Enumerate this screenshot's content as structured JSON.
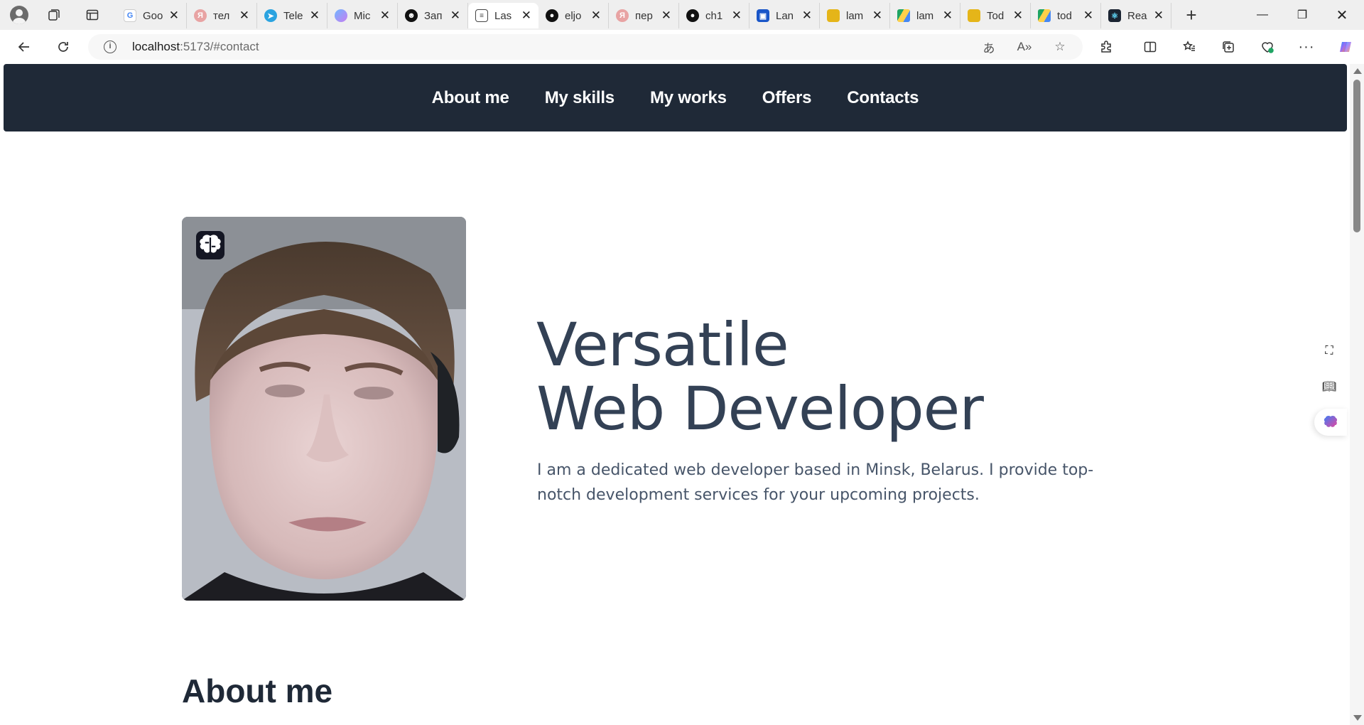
{
  "browser": {
    "tabs": [
      {
        "title": "Goo",
        "icon": "google-icon",
        "color": "#ffffff"
      },
      {
        "title": "тел",
        "icon": "yandex-icon",
        "color": "#e8a3a3"
      },
      {
        "title": "Tele",
        "icon": "telegram-icon",
        "color": "#2aa3e0"
      },
      {
        "title": "Mic",
        "icon": "copilot-icon",
        "color": "#8a7ef0"
      },
      {
        "title": "Зап",
        "icon": "chatbot-icon",
        "color": "#111111"
      },
      {
        "title": "Las",
        "icon": "page-icon",
        "color": "#444444"
      },
      {
        "title": "eljo",
        "icon": "github-icon",
        "color": "#111111"
      },
      {
        "title": "пер",
        "icon": "yandex-icon",
        "color": "#e8a3a3"
      },
      {
        "title": "ch1",
        "icon": "github-icon",
        "color": "#111111"
      },
      {
        "title": "Lan",
        "icon": "contact-icon",
        "color": "#1a56c8"
      },
      {
        "title": "lam",
        "icon": "sheet-icon",
        "color": "#e5b519"
      },
      {
        "title": "lam",
        "icon": "drive-icon",
        "color": "#1fa463"
      },
      {
        "title": "Tod",
        "icon": "sheet-icon",
        "color": "#e5b519"
      },
      {
        "title": "tod",
        "icon": "drive-icon",
        "color": "#1fa463"
      },
      {
        "title": "Rea",
        "icon": "react-icon",
        "color": "#1b2432"
      }
    ],
    "active_tab": 5,
    "url_host": "localhost",
    "url_path": ":5173/#contact"
  },
  "site": {
    "nav": [
      "About me",
      "My skills",
      "My works",
      "Offers",
      "Contacts"
    ],
    "hero": {
      "title_line1": "Versatile",
      "title_line2": "Web Developer",
      "description": "I am a dedicated web developer based in Minsk, Belarus. I provide top-notch development services for your upcoming projects."
    },
    "about_heading": "About me"
  },
  "colors": {
    "header_bg": "#1f2937",
    "title": "#334155",
    "text": "#475569"
  }
}
